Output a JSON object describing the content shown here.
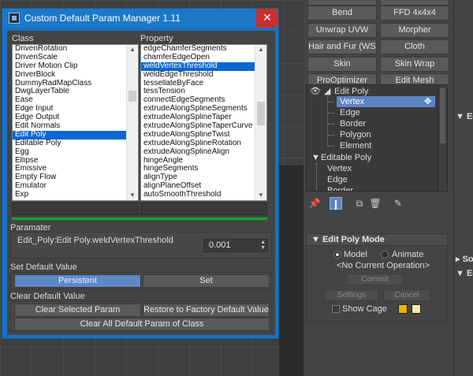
{
  "dialog": {
    "title": "Custom Default Param Manager 1.11",
    "close_glyph": "✕",
    "class_label": "Class",
    "property_label": "Property",
    "class_items": [
      "DrivenRotation",
      "DrivenScale",
      "Driver Motion Clip",
      "DriverBlock",
      "DummyRadMapClass",
      "DwgLayerTable",
      "Ease",
      "Edge Input",
      "Edge Output",
      "Edit Normals",
      "Edit Poly",
      "Editable Poly",
      "Egg",
      "Ellipse",
      "Emissive",
      "Empty Flow",
      "Emulator",
      "Exp"
    ],
    "class_selected_index": 10,
    "property_items": [
      "edgeChamferSegments",
      "chamferEdgeOpen",
      "weldVertexThreshold",
      "weldEdgeThreshold",
      "tessellateByFace",
      "tessTension",
      "connectEdgeSegments",
      "extrudeAlongSplineSegments",
      "extrudeAlongSplineTaper",
      "extrudeAlongSplineTaperCurve",
      "extrudeAlongSplineTwist",
      "extrudeAlongSplineRotation",
      "extrudeAlongSplineAlign",
      "hingeAngle",
      "hingeSegments",
      "alignType",
      "alignPlaneOffset",
      "autoSmoothThreshold"
    ],
    "property_selected_index": 2,
    "parameter_group_label": "Paramater",
    "parameter_path": "Edit_Poly:Edit Poly.weldVertexThreshold",
    "parameter_value": "0.001",
    "set_default_label": "Set Default Value",
    "persistent_label": "Persistent",
    "set_label": "Set",
    "clear_default_label": "Clear Default Value",
    "clear_selected_label": "Clear Selected Param",
    "restore_factory_label": "Restore to Factory Default Value",
    "clear_all_label": "Clear All Default Param of Class"
  },
  "command_panel": {
    "top_partial_left": "",
    "top_partial_right": "",
    "modifier_buttons": [
      "Bend",
      "FFD 4x4x4",
      "Unwrap UVW",
      "Morpher",
      "Hair and Fur (WSM)",
      "Cloth",
      "Skin",
      "Skin Wrap",
      "ProOptimizer",
      "Edit Mesh"
    ],
    "stack": {
      "edit_poly": "Edit Poly",
      "edit_poly_subs": [
        "Vertex",
        "Edge",
        "Border",
        "Polygon",
        "Element"
      ],
      "selected_sub": "Vertex",
      "editable_poly": "Editable Poly",
      "editable_poly_subs": [
        "Vertex",
        "Edge",
        "Border"
      ]
    },
    "rollout_title": "Edit Poly Mode",
    "model_label": "Model",
    "animate_label": "Animate",
    "mode_selected": "Model",
    "current_operation": "<No Current Operation>",
    "commit_label": "Commit",
    "settings_label": "Settings",
    "cancel_label": "Cancel",
    "show_cage_label": "Show Cage",
    "cage_colors": [
      "#e8b400",
      "#f3e8a0"
    ],
    "side_labels": [
      "Edit",
      "So",
      "Edi"
    ]
  },
  "colors": {
    "title_bar": "#1d78c8",
    "close": "#c8312d",
    "selection": "#0b67d1",
    "progress": "#06b025",
    "stack_selection": "#5b84c4"
  }
}
